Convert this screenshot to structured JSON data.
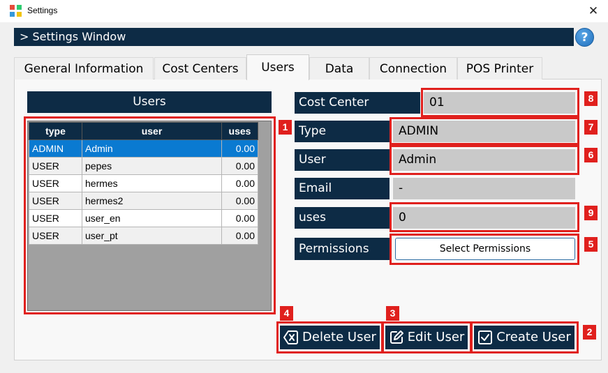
{
  "window": {
    "title": "Settings",
    "close_glyph": "✕"
  },
  "header": {
    "title": "> Settings Window",
    "help_label": "?"
  },
  "tabs": [
    {
      "label": "General Information"
    },
    {
      "label": "Cost Centers"
    },
    {
      "label": "Users",
      "active": true
    },
    {
      "label": "Data"
    },
    {
      "label": "Connection"
    },
    {
      "label": "POS Printer"
    }
  ],
  "users_panel": {
    "title": "Users",
    "columns": [
      "type",
      "user",
      "uses"
    ],
    "rows": [
      {
        "type": "ADMIN",
        "user": "Admin",
        "uses": "0.00",
        "selected": true
      },
      {
        "type": "USER",
        "user": "pepes",
        "uses": "0.00"
      },
      {
        "type": "USER",
        "user": "hermes",
        "uses": "0.00"
      },
      {
        "type": "USER",
        "user": "hermes2",
        "uses": "0.00"
      },
      {
        "type": "USER",
        "user": "user_en",
        "uses": "0.00"
      },
      {
        "type": "USER",
        "user": "user_pt",
        "uses": "0.00"
      }
    ]
  },
  "form": {
    "cost_center_label": "Cost Center",
    "cost_center_value": "01",
    "type_label": "Type",
    "type_value": "ADMIN",
    "user_label": "User",
    "user_value": "Admin",
    "email_label": "Email",
    "email_value": "-",
    "uses_label": "uses",
    "uses_value": "0",
    "permissions_label": "Permissions",
    "permissions_button": "Select Permissions"
  },
  "actions": {
    "delete_label": "Delete User",
    "edit_label": "Edit User",
    "create_label": "Create User"
  },
  "annotations": [
    "1",
    "2",
    "3",
    "4",
    "5",
    "6",
    "7",
    "8",
    "9"
  ],
  "colors": {
    "navy": "#0d2b45",
    "selection": "#0a7ad1",
    "annotation": "#e0201d",
    "field_gray": "#c9c9c9"
  },
  "icons": [
    "app-icon",
    "close-icon",
    "help-icon",
    "delete-icon",
    "edit-icon",
    "check-icon"
  ]
}
